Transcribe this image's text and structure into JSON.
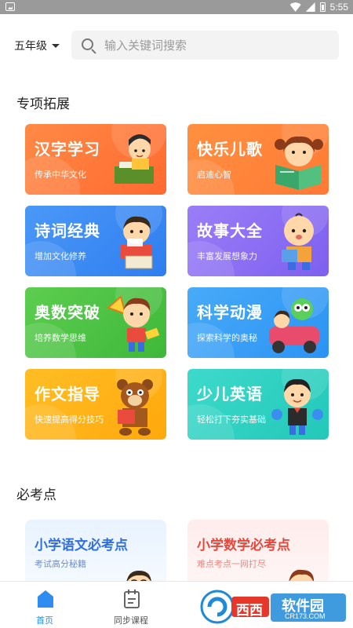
{
  "status_bar": {
    "time": "5:55"
  },
  "header": {
    "grade_label": "五年级",
    "search_placeholder": "输入关键词搜索"
  },
  "special": {
    "title": "专项拓展",
    "cards": [
      {
        "title": "汉字学习",
        "subtitle": "传承中华文化",
        "color": "#ff7a3c"
      },
      {
        "title": "快乐儿歌",
        "subtitle": "启迪心智",
        "color": "#ff8a3d"
      },
      {
        "title": "诗词经典",
        "subtitle": "增加文化修养",
        "color": "#3c8bf5"
      },
      {
        "title": "故事大全",
        "subtitle": "丰富发展想象力",
        "color": "#8a6ff5"
      },
      {
        "title": "奥数突破",
        "subtitle": "培养数学思维",
        "color": "#4cc447"
      },
      {
        "title": "科学动漫",
        "subtitle": "探索科学的奥秘",
        "color": "#3aa2f7"
      },
      {
        "title": "作文指导",
        "subtitle": "快速提高得分技巧",
        "color": "#ffb414"
      },
      {
        "title": "少儿英语",
        "subtitle": "轻松打下夯实基础",
        "color": "#2ed3c6"
      }
    ]
  },
  "key_points": {
    "title": "必考点",
    "cards": [
      {
        "title": "小学语文必考点",
        "subtitle": "考试高分秘籍"
      },
      {
        "title": "小学数学必考点",
        "subtitle": "难点考点一网打尽"
      }
    ]
  },
  "bottom_nav": {
    "items": [
      {
        "label": "首页",
        "active": true
      },
      {
        "label": "同步课程",
        "active": false
      }
    ]
  },
  "watermark": {
    "brand": "西西",
    "text": "软件园",
    "domain": "CR173.COM"
  }
}
